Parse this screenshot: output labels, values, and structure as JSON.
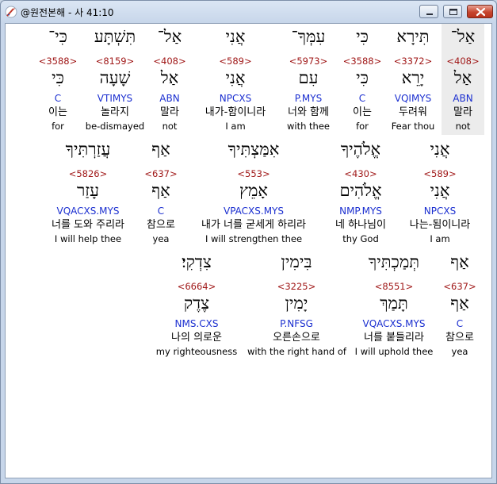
{
  "window": {
    "title": "@원전본해 - 사 41:10",
    "icon": "app-bible-icon",
    "controls": [
      "minimize-icon",
      "maximize-icon",
      "close-icon"
    ]
  },
  "rows": [
    {
      "words": [
        {
          "heb": "כִּי־",
          "num": "<3588>",
          "lemma": "כִּי",
          "code": "C",
          "kor": "이는",
          "eng": "for"
        },
        {
          "heb": "תִּשְׁתָּע",
          "num": "<8159>",
          "lemma": "שָׁעָה",
          "code": "VTIMYS",
          "kor": "놀라지",
          "eng": "be-dismayed"
        },
        {
          "heb": "אַל־",
          "num": "<408>",
          "lemma": "אַל",
          "code": "ABN",
          "kor": "말라",
          "eng": "not"
        },
        {
          "heb": "אֲנִי",
          "num": "<589>",
          "lemma": "אֲנִי",
          "code": "NPCXS",
          "kor": "내가-함이니라",
          "eng": "I am"
        },
        {
          "heb": "עִמְּךָ־",
          "num": "<5973>",
          "lemma": "עִם",
          "code": "P.MYS",
          "kor": "너와 함께",
          "eng": "with thee"
        },
        {
          "heb": "כִּי",
          "num": "<3588>",
          "lemma": "כִּי",
          "code": "C",
          "kor": "이는",
          "eng": "for"
        },
        {
          "heb": "תִּירָא",
          "num": "<3372>",
          "lemma": "יָרֵא",
          "code": "VQIMYS",
          "kor": "두려워",
          "eng": "Fear thou"
        },
        {
          "heb": "אַל־",
          "num": "<408>",
          "lemma": "אַל",
          "code": "ABN",
          "kor": "말라",
          "eng": "not",
          "selected": true
        }
      ]
    },
    {
      "words": [
        {
          "heb": "עֲזַרְתִּיךָ",
          "num": "<5826>",
          "lemma": "עָזַר",
          "code": "VQACXS.MYS",
          "kor": "너를 도와 주리라",
          "eng": "I will help thee"
        },
        {
          "heb": "אַף",
          "num": "<637>",
          "lemma": "אַף",
          "code": "C",
          "kor": "참으로",
          "eng": "yea"
        },
        {
          "heb": "אִמַּצְתִּיךָ",
          "num": "<553>",
          "lemma": "אָמֵץ",
          "code": "VPACXS.MYS",
          "kor": "내가 너를 굳세게 하리라",
          "eng": "I will strengthen thee"
        },
        {
          "heb": "אֱלֹהֶיךָ",
          "num": "<430>",
          "lemma": "אֱלֹהִים",
          "code": "NMP.MYS",
          "kor": "네 하나님이",
          "eng": "thy God"
        },
        {
          "heb": "אֲנִי",
          "num": "<589>",
          "lemma": "אֲנִי",
          "code": "NPCXS",
          "kor": "나는-됨이니라",
          "eng": "I am"
        }
      ]
    },
    {
      "words": [
        {
          "heb": "צִדְקִי׃",
          "num": "<6664>",
          "lemma": "צֶדֶק",
          "code": "NMS.CXS",
          "kor": "나의 의로운",
          "eng": "my righteousness"
        },
        {
          "heb": "בִּימִין",
          "num": "<3225>",
          "lemma": "יָמִין",
          "code": "P.NFSG",
          "kor": "오른손으로",
          "eng": "with the right hand of"
        },
        {
          "heb": "תְּמַכְתִּיךָ",
          "num": "<8551>",
          "lemma": "תָּמַךְ",
          "code": "VQACXS.MYS",
          "kor": "너를 붙들리라",
          "eng": "I will uphold thee"
        },
        {
          "heb": "אַף",
          "num": "<637>",
          "lemma": "אַף",
          "code": "C",
          "kor": "참으로",
          "eng": "yea"
        }
      ]
    }
  ]
}
